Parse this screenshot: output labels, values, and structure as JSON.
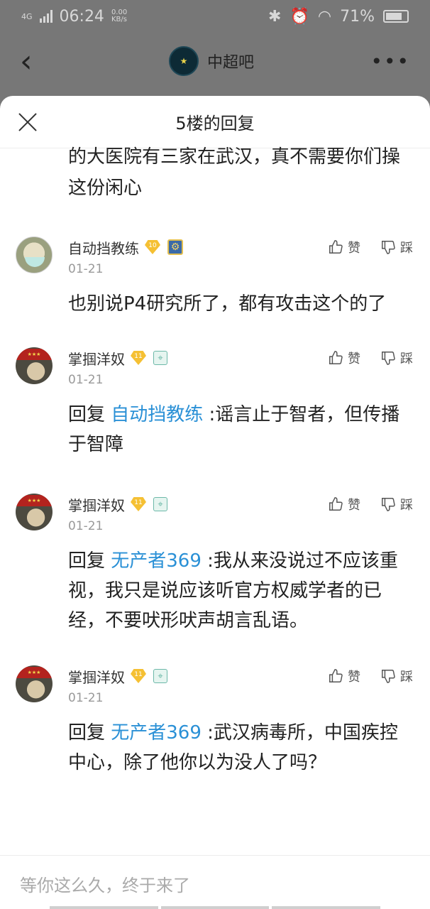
{
  "status": {
    "network": "4G",
    "time": "06:24",
    "speed_value": "0.00",
    "speed_unit": "KB/s",
    "battery": "71%"
  },
  "header": {
    "forum_name": "中超吧",
    "more_label": "•••"
  },
  "sheet": {
    "title": "5楼的回复",
    "continued_text": "的大医院有三家在武汉，真不需要你们操这份闲心"
  },
  "actions": {
    "like": "赞",
    "dislike": "踩"
  },
  "replies": [
    {
      "user": "自动挡教练",
      "level": "10",
      "date": "01-21",
      "prefix": "",
      "mention": "",
      "text": "也别说P4研究所了，都有攻击这个的了"
    },
    {
      "user": "掌掴洋奴",
      "level": "11",
      "date": "01-21",
      "prefix": "回复 ",
      "mention": "自动挡教练",
      "text": " :谣言止于智者，但传播于智障"
    },
    {
      "user": "掌掴洋奴",
      "level": "11",
      "date": "01-21",
      "prefix": "回复 ",
      "mention": "无产者369",
      "text": " :我从来没说过不应该重视，我只是说应该听官方权威学者的已经，不要吠形吠声胡言乱语。"
    },
    {
      "user": "掌掴洋奴",
      "level": "11",
      "date": "01-21",
      "prefix": "回复 ",
      "mention": "无产者369",
      "text": " :武汉病毒所，中国疾控中心，除了他你以为没人了吗？"
    }
  ],
  "composer": {
    "placeholder": "等你这么久，终于来了"
  }
}
